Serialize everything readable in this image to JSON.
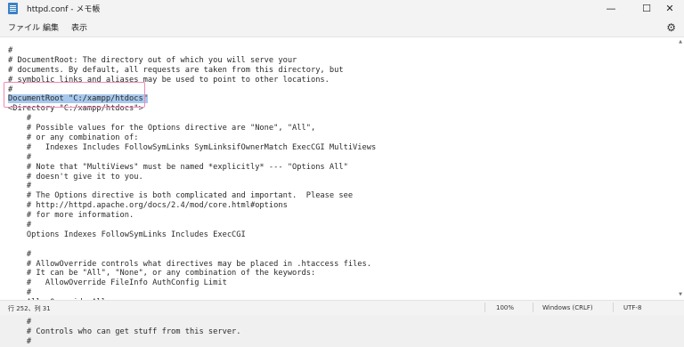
{
  "window": {
    "title": "httpd.conf - メモ帳",
    "minimize": "—",
    "maximize": "☐",
    "close": "✕"
  },
  "menu": {
    "file": "ファイル",
    "edit": "編集",
    "view": "表示",
    "settings_icon": "gear-icon"
  },
  "editor": {
    "lines": [
      "#",
      "# DocumentRoot: The directory out of which you will serve your",
      "# documents. By default, all requests are taken from this directory, but",
      "# symbolic links and aliases may be used to point to other locations.",
      "#",
      "DocumentRoot \"C:/xampp/htdocs\"",
      "<Directory \"C:/xampp/htdocs\">",
      "    #",
      "    # Possible values for the Options directive are \"None\", \"All\",",
      "    # or any combination of:",
      "    #   Indexes Includes FollowSymLinks SymLinksifOwnerMatch ExecCGI MultiViews",
      "    #",
      "    # Note that \"MultiViews\" must be named *explicitly* --- \"Options All\"",
      "    # doesn't give it to you.",
      "    #",
      "    # The Options directive is both complicated and important.  Please see",
      "    # http://httpd.apache.org/docs/2.4/mod/core.html#options",
      "    # for more information.",
      "    #",
      "    Options Indexes FollowSymLinks Includes ExecCGI",
      "",
      "    #",
      "    # AllowOverride controls what directives may be placed in .htaccess files.",
      "    # It can be \"All\", \"None\", or any combination of the keywords:",
      "    #   AllowOverride FileInfo AuthConfig Limit",
      "    #",
      "    AllowOverride All",
      "",
      "    #",
      "    # Controls who can get stuff from this server.",
      "    #"
    ],
    "selected_line_index": 5
  },
  "status": {
    "position": "行 252、列 31",
    "zoom": "100%",
    "line_ending": "Windows (CRLF)",
    "encoding": "UTF-8"
  }
}
